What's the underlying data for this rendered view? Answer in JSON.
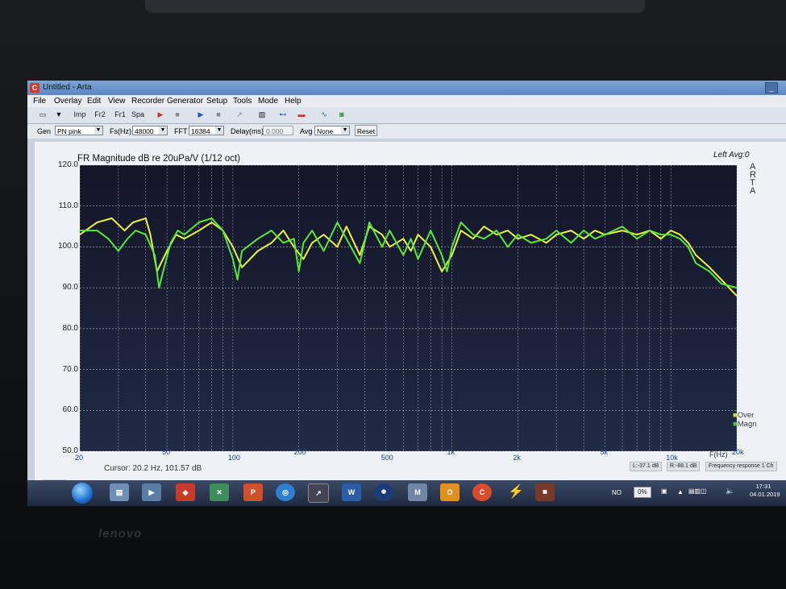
{
  "window": {
    "app_icon": "C",
    "title": "Untitled - Arta"
  },
  "menu": [
    "File",
    "Overlay",
    "Edit",
    "View",
    "Recorder",
    "Generator",
    "Setup",
    "Tools",
    "Mode",
    "Help"
  ],
  "toolbar": {
    "imp": "Imp",
    "fr2": "Fr2",
    "fr1": "Fr1",
    "spa": "Spa"
  },
  "gen_bar": {
    "gen_label": "Gen",
    "gen_value": "PN pink",
    "fs_label": "Fs(Hz)",
    "fs_value": "48000",
    "fft_label": "FFT",
    "fft_value": "16384",
    "delay_label": "Delay(ms)",
    "delay_value": "0.000",
    "avg_label": "Avg",
    "avg_value": "None",
    "reset_label": "Reset"
  },
  "plot": {
    "title": "FR Magnitude dB re 20uPa/V (1/12 oct)",
    "channel": "Left  Avg:0",
    "side_letters": [
      "A",
      "R",
      "T",
      "A"
    ],
    "cursor": "Cursor:   20.2 Hz, 101.57 dB",
    "legend": [
      "Over",
      "Magn"
    ],
    "status": [
      "L:-37.1 dB",
      "R:-88.1 dB",
      "Frequency response 1 Ch"
    ]
  },
  "chart_data": {
    "type": "line",
    "xlabel": "F(Hz)",
    "ylim": [
      50,
      120
    ],
    "xlim": [
      20,
      20000
    ],
    "x_scale": "log",
    "y_ticks": [
      "120.0",
      "110.0",
      "100.0",
      "90.0",
      "80.0",
      "70.0",
      "60.0",
      "50.0"
    ],
    "x_ticks": [
      "20",
      "50",
      "100",
      "200",
      "500",
      "1k",
      "2k",
      "5k",
      "10k",
      "20k"
    ],
    "grid": true,
    "colors": {
      "over": "#e9f246",
      "magn": "#58e83a",
      "background": "#14162a",
      "grid": "#ffffff"
    },
    "series": [
      {
        "name": "Over",
        "x": [
          20,
          24,
          28,
          32,
          35,
          40,
          42,
          45,
          50,
          55,
          60,
          70,
          80,
          90,
          100,
          110,
          130,
          150,
          170,
          190,
          210,
          230,
          260,
          300,
          330,
          380,
          420,
          480,
          520,
          600,
          650,
          700,
          800,
          900,
          1000,
          1100,
          1250,
          1400,
          1600,
          1800,
          2000,
          2300,
          2700,
          3000,
          3500,
          4000,
          4500,
          5000,
          6000,
          7000,
          8000,
          9000,
          10000,
          11000,
          12000,
          13000,
          15000,
          17000,
          20000
        ],
        "y": [
          103,
          106,
          107,
          104,
          106,
          107,
          103,
          94,
          99,
          103,
          102,
          104,
          106,
          104,
          100,
          95,
          99,
          101,
          104,
          100,
          97,
          101,
          103,
          100,
          105,
          98,
          105,
          103,
          100,
          102,
          99,
          103,
          100,
          94,
          98,
          104,
          102,
          105,
          103,
          104,
          102,
          103,
          101,
          103,
          104,
          102,
          104,
          103,
          104,
          103,
          104,
          102,
          104,
          103,
          101,
          98,
          95,
          92,
          88
        ]
      },
      {
        "name": "Magn",
        "x": [
          20,
          24,
          27,
          30,
          33,
          36,
          40,
          44,
          46,
          48,
          52,
          56,
          60,
          70,
          80,
          90,
          100,
          105,
          110,
          130,
          150,
          170,
          190,
          200,
          210,
          230,
          260,
          300,
          330,
          380,
          420,
          480,
          520,
          600,
          650,
          700,
          800,
          900,
          950,
          1000,
          1100,
          1250,
          1400,
          1600,
          1800,
          2000,
          2300,
          2700,
          3000,
          3500,
          4000,
          4500,
          5000,
          6000,
          7000,
          8000,
          9000,
          10000,
          11000,
          12000,
          13000,
          15000,
          17000,
          20000
        ],
        "y": [
          104,
          104,
          102,
          99,
          102,
          104,
          103,
          98,
          90,
          94,
          101,
          104,
          103,
          106,
          107,
          104,
          97,
          92,
          99,
          102,
          104,
          101,
          102,
          94,
          101,
          104,
          99,
          106,
          102,
          96,
          106,
          100,
          104,
          98,
          102,
          97,
          104,
          98,
          94,
          100,
          106,
          103,
          102,
          104,
          100,
          103,
          101,
          102,
          104,
          101,
          104,
          102,
          103,
          105,
          102,
          104,
          103,
          103,
          102,
          100,
          96,
          94,
          91,
          90
        ]
      }
    ]
  }
}
